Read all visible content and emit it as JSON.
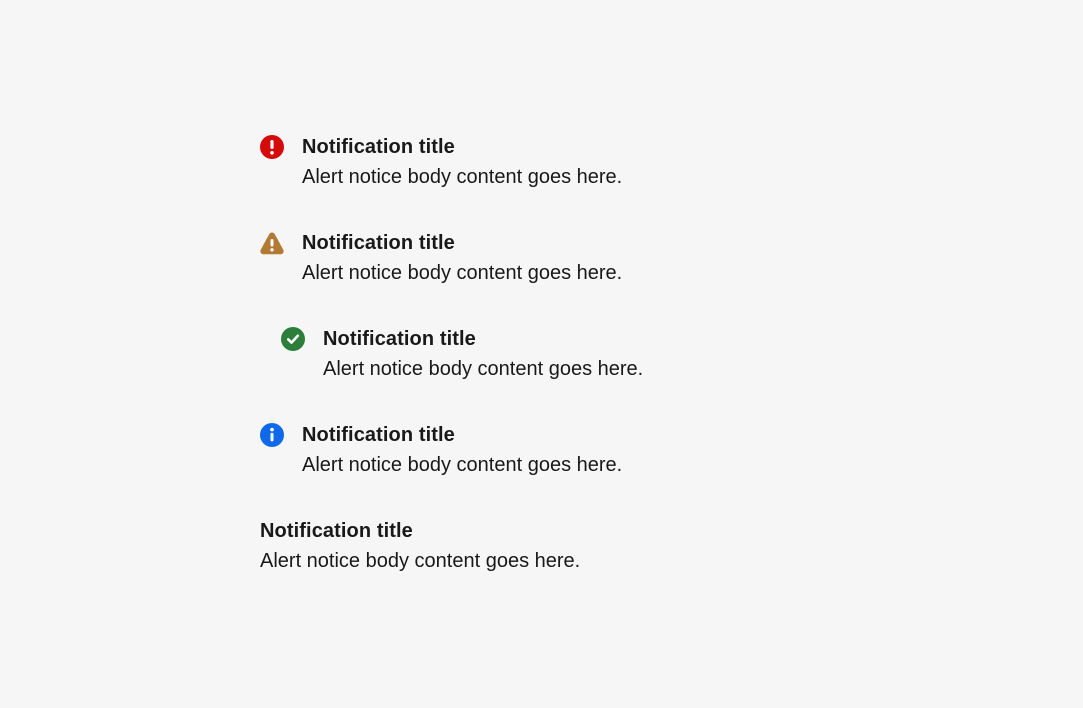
{
  "colors": {
    "background": "#f6f6f6",
    "text": "#191919",
    "attention": "#d50b0b",
    "warning": "#b27a34",
    "success": "#2b7f3a",
    "information": "#0f69e8"
  },
  "notices": [
    {
      "icon": "attention-icon",
      "title": "Notification title",
      "body": "Alert notice body content goes here."
    },
    {
      "icon": "warning-icon",
      "title": "Notification title",
      "body": "Alert notice body content goes here."
    },
    {
      "icon": "success-icon",
      "title": "Notification title",
      "body": "Alert notice body content goes here."
    },
    {
      "icon": "information-icon",
      "title": "Notification title",
      "body": "Alert notice body content goes here."
    },
    {
      "icon": "",
      "title": "Notification title",
      "body": "Alert notice body content goes here."
    }
  ]
}
